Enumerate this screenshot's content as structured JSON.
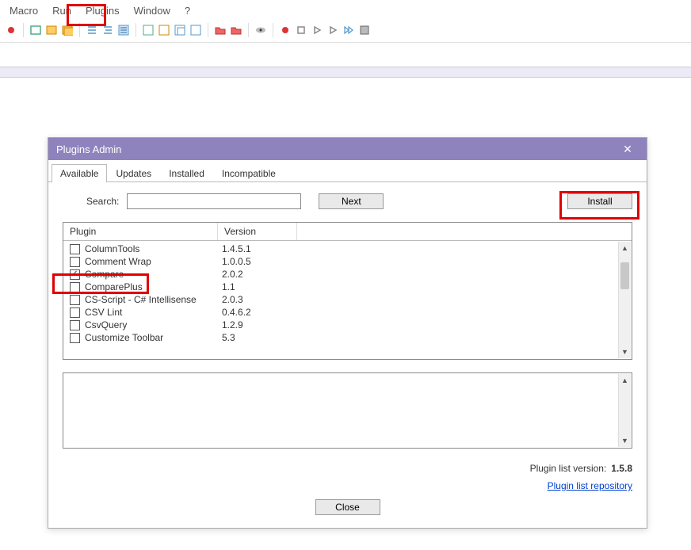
{
  "menu": {
    "items": [
      "Macro",
      "Run",
      "Plugins",
      "Window",
      "?"
    ]
  },
  "dialog": {
    "title": "Plugins Admin",
    "tabs": [
      "Available",
      "Updates",
      "Installed",
      "Incompatible"
    ],
    "active_tab": 0,
    "search_label": "Search:",
    "search_value": "",
    "next_label": "Next",
    "install_label": "Install",
    "columns": {
      "plugin": "Plugin",
      "version": "Version"
    },
    "rows": [
      {
        "name": "ColumnTools",
        "version": "1.4.5.1",
        "checked": false
      },
      {
        "name": "Comment Wrap",
        "version": "1.0.0.5",
        "checked": false
      },
      {
        "name": "Compare",
        "version": "2.0.2",
        "checked": true
      },
      {
        "name": "ComparePlus",
        "version": "1.1",
        "checked": false
      },
      {
        "name": "CS-Script - C# Intellisense",
        "version": "2.0.3",
        "checked": false
      },
      {
        "name": "CSV Lint",
        "version": "0.4.6.2",
        "checked": false
      },
      {
        "name": "CsvQuery",
        "version": "1.2.9",
        "checked": false
      },
      {
        "name": "Customize Toolbar",
        "version": "5.3",
        "checked": false
      }
    ],
    "plugin_list_label": "Plugin list version:",
    "plugin_list_version": "1.5.8",
    "repo_link": "Plugin list repository",
    "close_label": "Close"
  }
}
